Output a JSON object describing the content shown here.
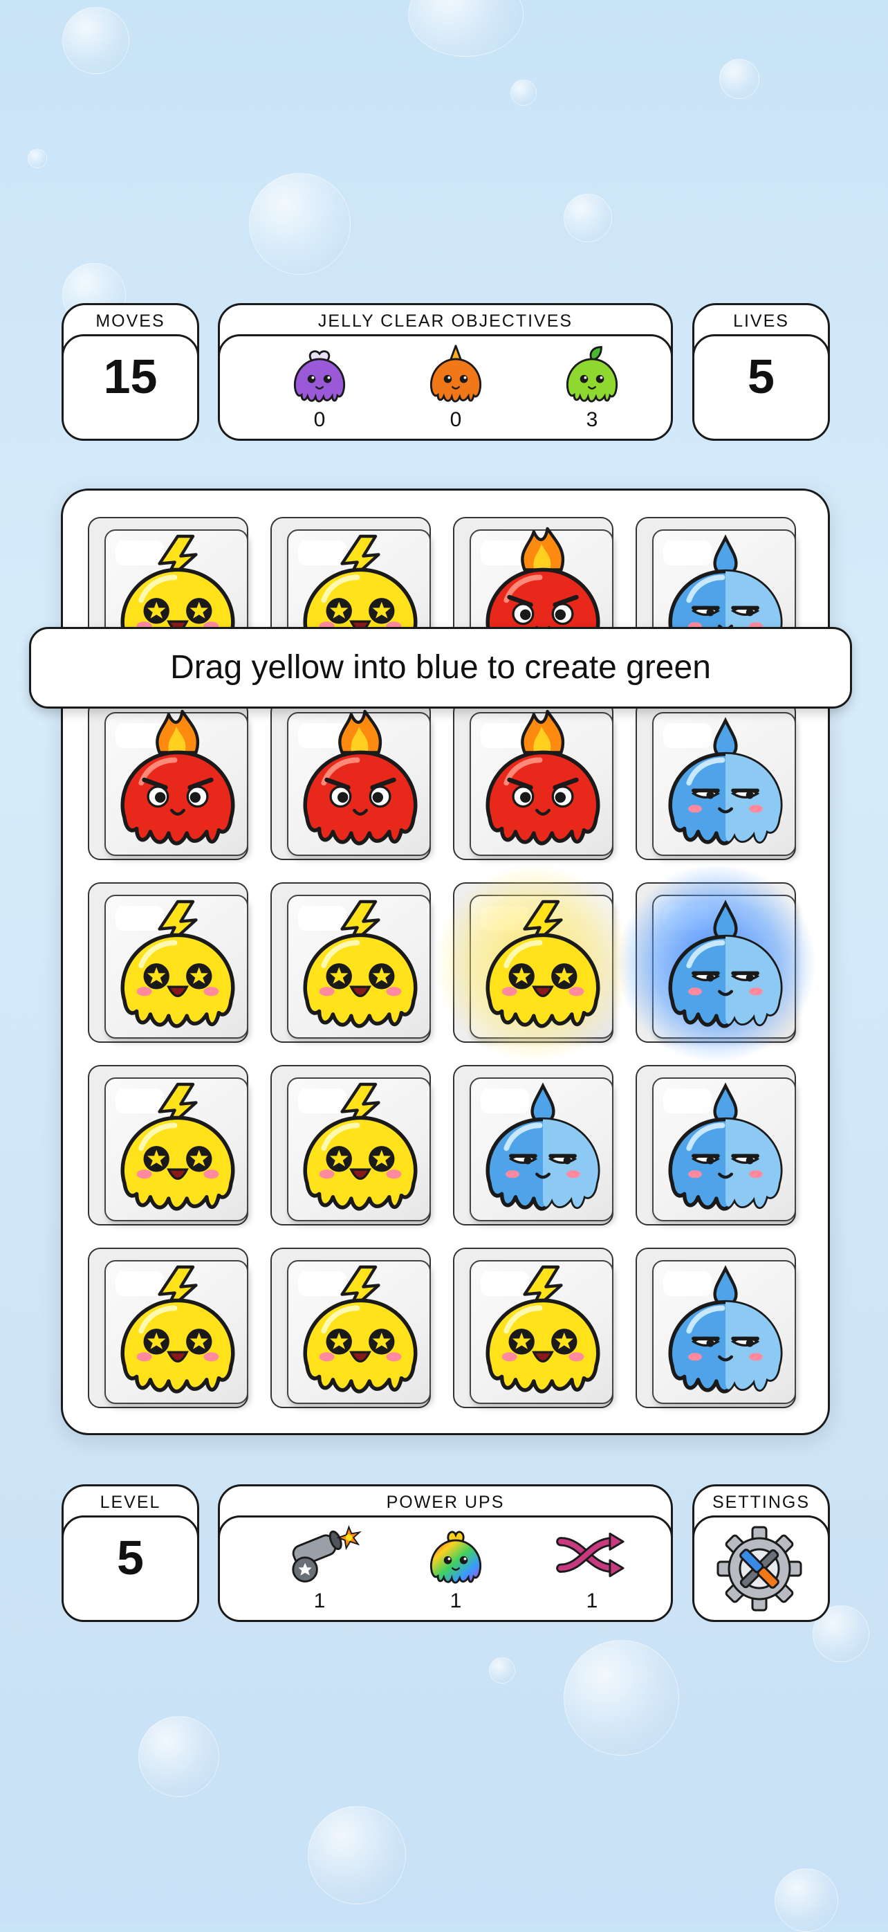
{
  "hud": {
    "moves": {
      "label": "MOVES",
      "value": "15"
    },
    "objectives": {
      "label": "JELLY CLEAR OBJECTIVES",
      "items": [
        {
          "icon": "purple-jelly-icon",
          "count": "0"
        },
        {
          "icon": "orange-jelly-icon",
          "count": "0"
        },
        {
          "icon": "green-jelly-icon",
          "count": "3"
        }
      ]
    },
    "lives": {
      "label": "LIVES",
      "value": "5"
    }
  },
  "hint": "Drag yellow into blue to create green",
  "board": {
    "rows": 5,
    "cols": 4,
    "tiles": [
      [
        "yellow",
        "yellow",
        "red",
        "blue"
      ],
      [
        "red",
        "red",
        "red",
        "blue"
      ],
      [
        "yellow",
        "yellow",
        "yellow",
        "blue"
      ],
      [
        "yellow",
        "yellow",
        "blue",
        "blue"
      ],
      [
        "yellow",
        "yellow",
        "yellow",
        "blue"
      ]
    ],
    "highlighted": [
      "row 3 col 3 yellow",
      "row 3 col 4 blue"
    ]
  },
  "footer": {
    "level": {
      "label": "LEVEL",
      "value": "5"
    },
    "powerups": {
      "label": "POWER UPS",
      "items": [
        {
          "icon": "cannon-icon",
          "count": "1"
        },
        {
          "icon": "rainbow-jelly-icon",
          "count": "1"
        },
        {
          "icon": "shuffle-icon",
          "count": "1"
        }
      ]
    },
    "settings": {
      "label": "SETTINGS",
      "icon": "settings-gear-icon"
    }
  },
  "colors": {
    "yellow": "#ffe21a",
    "red": "#e8281a",
    "blue": "#4fa3e8",
    "purple": "#9a5ad8",
    "orange": "#f07818",
    "green": "#8ed830",
    "outline": "#1a1a1a"
  }
}
